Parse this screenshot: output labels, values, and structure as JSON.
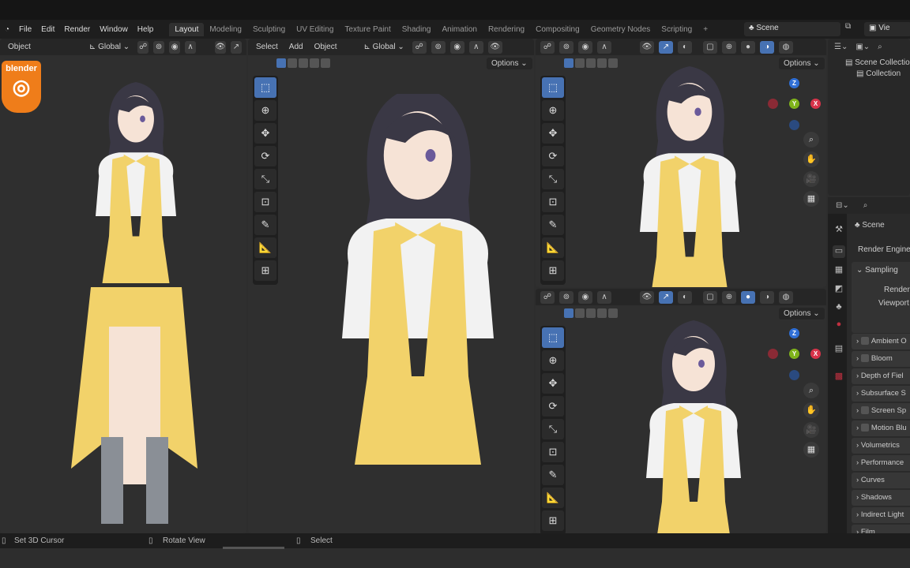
{
  "menubar": {
    "items": [
      "File",
      "Edit",
      "Render",
      "Window",
      "Help"
    ],
    "workspaces": [
      "Layout",
      "Modeling",
      "Sculpting",
      "UV Editing",
      "Texture Paint",
      "Shading",
      "Animation",
      "Rendering",
      "Compositing",
      "Geometry Nodes",
      "Scripting",
      "+"
    ],
    "active_workspace": "Layout",
    "scene": "Scene",
    "view_layer": "Vie"
  },
  "logo": "blender",
  "left_viewport": {
    "menus": [
      "Object"
    ],
    "orientation": "Global"
  },
  "mid_viewport": {
    "menus": [
      "Select",
      "Add",
      "Object"
    ],
    "orientation": "Global",
    "options": "Options"
  },
  "right_top_viewport": {
    "options": "Options"
  },
  "right_bottom_viewport": {
    "options": "Options"
  },
  "gizmo": {
    "x": "X",
    "y": "Y",
    "z": "Z"
  },
  "outliner": {
    "items": [
      "Scene Collection",
      "Collection"
    ]
  },
  "properties": {
    "scene": "Scene",
    "render_engine": "Render Engine",
    "sampling": "Sampling",
    "render": "Render",
    "viewport": "Viewport",
    "panels": [
      {
        "label": "Ambient O",
        "checkbox": true
      },
      {
        "label": "Bloom",
        "checkbox": true
      },
      {
        "label": "Depth of Fiel",
        "checkbox": false
      },
      {
        "label": "Subsurface S",
        "checkbox": false
      },
      {
        "label": "Screen Sp",
        "checkbox": true
      },
      {
        "label": "Motion Blu",
        "checkbox": true
      },
      {
        "label": "Volumetrics",
        "checkbox": false
      },
      {
        "label": "Performance",
        "checkbox": false
      },
      {
        "label": "Curves",
        "checkbox": false
      },
      {
        "label": "Shadows",
        "checkbox": false
      },
      {
        "label": "Indirect Light",
        "checkbox": false
      },
      {
        "label": "Film",
        "checkbox": false
      }
    ]
  },
  "statusbar": {
    "items": [
      "Set 3D Cursor",
      "Rotate View",
      "Select"
    ]
  },
  "colors": {
    "accent": "#4772b3",
    "hair": "#3a3845",
    "vest": "#f2d26a",
    "skin": "#f6e3d6",
    "shirt": "#f2f2f2",
    "boots": "#8a8f96"
  }
}
